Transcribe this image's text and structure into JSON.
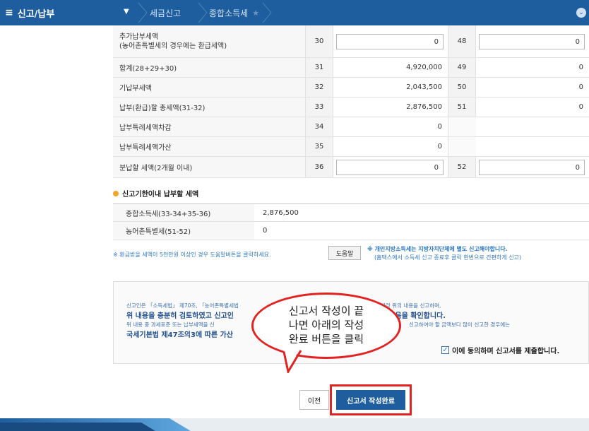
{
  "header": {
    "menu_label": "신고/납부",
    "breadcrumb": [
      "세금신고",
      "종합소득세"
    ]
  },
  "table": {
    "rows": [
      {
        "label_line1": "추가납부세액",
        "label_line2": "(농어촌특별세의 경우에는 환급세액)",
        "code1": "30",
        "value1": "0",
        "code2": "48",
        "value2": "0"
      },
      {
        "label": "합계(28+29+30)",
        "code1": "31",
        "value1": "4,920,000",
        "code2": "49",
        "value2": "0"
      },
      {
        "label": "기납부세액",
        "code1": "32",
        "value1": "2,043,500",
        "code2": "50",
        "value2": "0"
      },
      {
        "label": "납부(환급)할 총세액(31-32)",
        "code1": "33",
        "value1": "2,876,500",
        "code2": "51",
        "value2": "0"
      },
      {
        "label": "납부특례세액차감",
        "code1": "34",
        "value1": "0"
      },
      {
        "label": "납부특례세액가산",
        "code1": "35",
        "value1": "0"
      },
      {
        "label": "분납할 세액(2개월 이내)",
        "code1": "36",
        "value1": "0",
        "code2": "52",
        "value2": "0"
      }
    ]
  },
  "deadline": {
    "title": "신고기한이내 납부할 세액",
    "rows": [
      {
        "label": "종합소득세(33-34+35-36)",
        "value": "2,876,500"
      },
      {
        "label": "농어촌특별세(51-52)",
        "value": "0"
      }
    ]
  },
  "notes": {
    "refund_note": "※ 환급받을 세액이 5천만원 이상인 경우 도움말버튼을 클릭하세요.",
    "help_button": "도움말",
    "local_tax_line1": "※ 개인지방소득세는 지방자치단체에 별도 신고해야합니다.",
    "local_tax_line2": "(홈택스에서 소득세 신고 종료후 클릭 한번으로 간편하게 신고)"
  },
  "declaration": {
    "line1": "신고인은 「소득세법」 제70조, 「농어촌특별세법",
    "line1b": "따라 위의 내용을 신고하며,",
    "line2": "위 내용을 충분히 검토하였고 신고인",
    "line2b": "적었음을 확인합니다.",
    "line3": "위 내용 중 과세표준 또는 납부세액을 신",
    "line3b": "신고하여야 할 금액보다 많이 신고한 경우에는",
    "line4": "국세기본법 제47조의3에 따른 가산",
    "agree_label": "이에 동의하며 신고서를 제출합니다."
  },
  "callout": {
    "line1": "신고서 작성이 끝",
    "line2": "나면 아래의 작성",
    "line3": "완료 버튼을 클릭"
  },
  "buttons": {
    "prev": "이전",
    "done": "신고서 작성완료"
  },
  "colors": {
    "header_bg": "#1f5e9e",
    "highlight": "#e32222",
    "link_blue": "#2b77c4"
  }
}
